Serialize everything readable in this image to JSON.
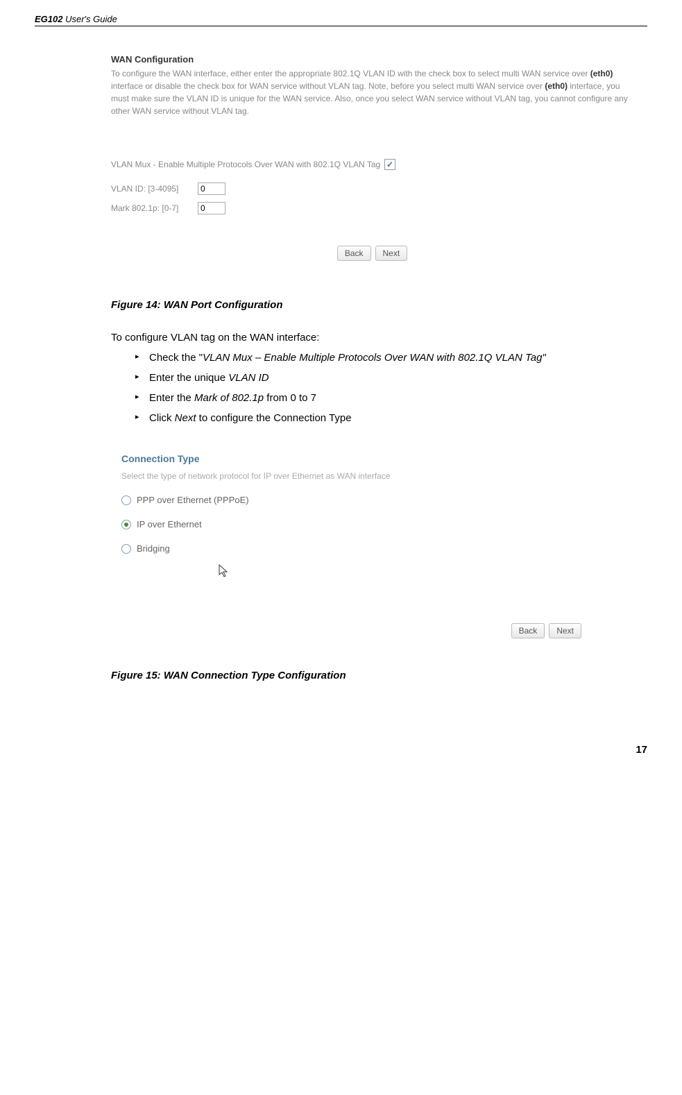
{
  "header": {
    "product": "EG102",
    "subtitle": "User's Guide"
  },
  "screenshot1": {
    "title": "WAN Configuration",
    "desc_part1": "To configure the WAN interface, either enter the appropriate 802.1Q VLAN ID with the check box to select multi WAN service over ",
    "eth1": "(eth0)",
    "desc_part2": " interface or disable the check box for WAN service without VLAN tag. Note, before you select multi WAN service over ",
    "eth2": "(eth0)",
    "desc_part3": " interface, you must make sure the VLAN ID is unique for the WAN service. Also, once you select WAN service without VLAN tag, you cannot configure any other WAN service without VLAN tag.",
    "vlan_mux_label": "VLAN Mux - Enable Multiple Protocols Over WAN with 802.1Q VLAN Tag",
    "vlan_id_label": "VLAN ID: [3-4095]",
    "vlan_id_value": "0",
    "mark_label": "Mark 802.1p: [0-7]",
    "mark_value": "0",
    "back_btn": "Back",
    "next_btn": "Next"
  },
  "figure14": "Figure 14: WAN Port Configuration",
  "intro": "To configure VLAN tag on the WAN interface:",
  "bullets": {
    "b1_pre": "Check the \"",
    "b1_italic": "VLAN Mux – Enable Multiple Protocols Over WAN with 802.1Q VLAN Tag\"",
    "b2_pre": "Enter the unique ",
    "b2_italic": "VLAN ID",
    "b3_pre": "Enter the ",
    "b3_italic": "Mark of 802.1p",
    "b3_post": " from 0 to 7",
    "b4_pre": "Click ",
    "b4_italic": "Next",
    "b4_post": " to configure the Connection Type"
  },
  "screenshot2": {
    "title": "Connection Type",
    "desc": "Select the type of network protocol for IP over Ethernet as WAN interface",
    "opt1": "PPP over Ethernet (PPPoE)",
    "opt2": "IP over Ethernet",
    "opt3": "Bridging",
    "back_btn": "Back",
    "next_btn": "Next"
  },
  "figure15": "Figure 15: WAN Connection Type Configuration",
  "page_number": "17"
}
